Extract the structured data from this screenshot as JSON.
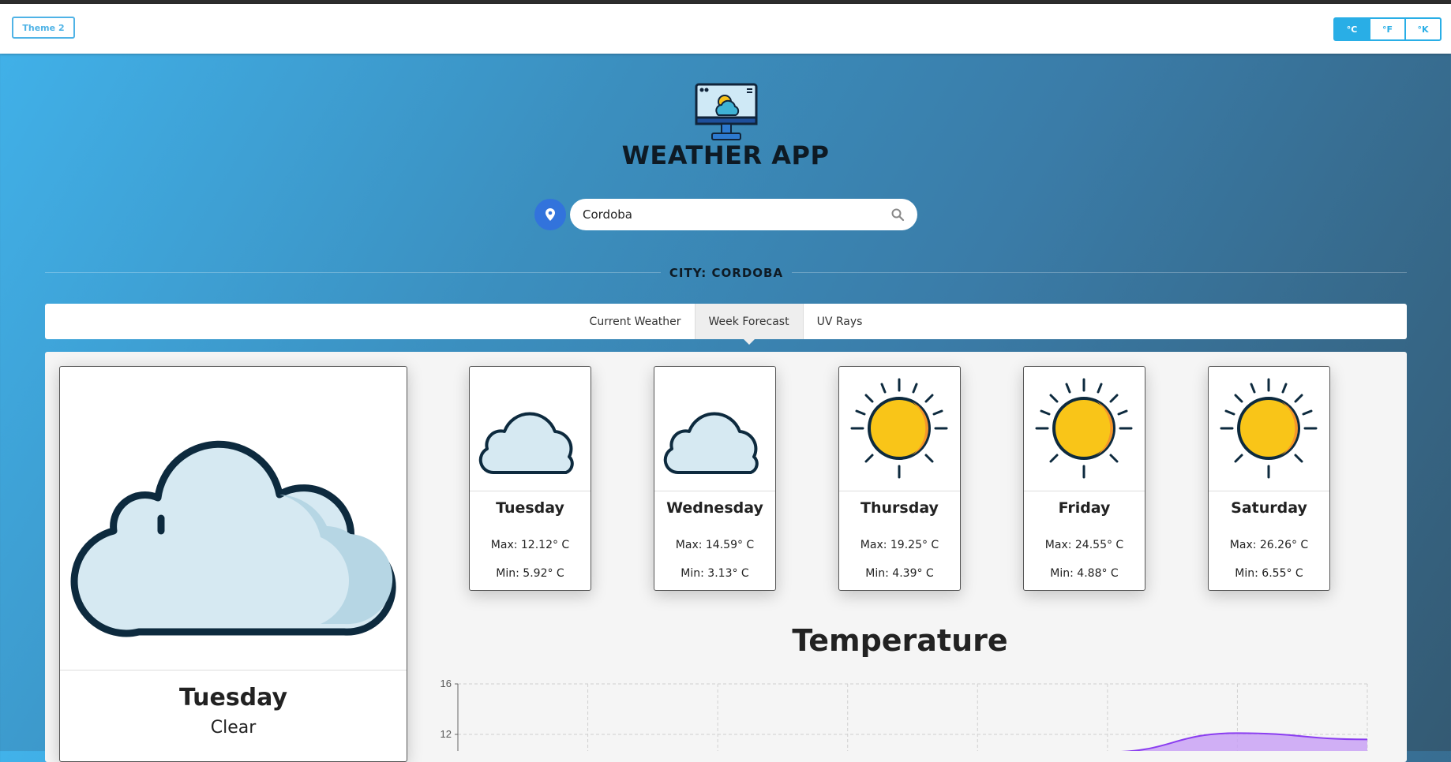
{
  "navbar": {
    "theme_label": "Theme 2",
    "units": [
      {
        "label": "°C",
        "active": true
      },
      {
        "label": "°F",
        "active": false
      },
      {
        "label": "°K",
        "active": false
      }
    ]
  },
  "header": {
    "title": "WEATHER APP",
    "logo_icon": "weather-monitor-icon"
  },
  "search": {
    "value": "Cordoba",
    "location_icon": "location-pin-icon",
    "search_icon": "search-icon"
  },
  "city_label": "CITY: CORDOBA",
  "tabs": [
    {
      "label": "Current Weather",
      "active": false
    },
    {
      "label": "Week Forecast",
      "active": true
    },
    {
      "label": "UV Rays",
      "active": false
    }
  ],
  "today": {
    "day": "Tuesday",
    "description": "Clear",
    "icon": "cloud-icon"
  },
  "forecast": [
    {
      "day": "Tuesday",
      "max": "Max: 12.12° C",
      "min": "Min: 5.92° C",
      "icon": "cloud-icon"
    },
    {
      "day": "Wednesday",
      "max": "Max: 14.59° C",
      "min": "Min: 3.13° C",
      "icon": "cloud-icon"
    },
    {
      "day": "Thursday",
      "max": "Max: 19.25° C",
      "min": "Min: 4.39° C",
      "icon": "sun-icon"
    },
    {
      "day": "Friday",
      "max": "Max: 24.55° C",
      "min": "Min: 4.88° C",
      "icon": "sun-icon"
    },
    {
      "day": "Saturday",
      "max": "Max: 26.26° C",
      "min": "Min: 6.55° C",
      "icon": "sun-icon"
    }
  ],
  "colors": {
    "accent": "#29aee6",
    "location_button": "#3273dc",
    "chart_fill": "#c9a2f4",
    "chart_line": "#8a3df0"
  },
  "chart_data": {
    "type": "area",
    "title": "Temperature",
    "ytick_labels": [
      "16",
      "12"
    ],
    "ylim": [
      10,
      16
    ],
    "grid": true,
    "series": [
      {
        "x": [
          0,
          1,
          2,
          3,
          4,
          5,
          6,
          7
        ],
        "values": [
          null,
          null,
          null,
          null,
          null,
          10.6,
          12.1,
          11.6
        ]
      }
    ]
  }
}
